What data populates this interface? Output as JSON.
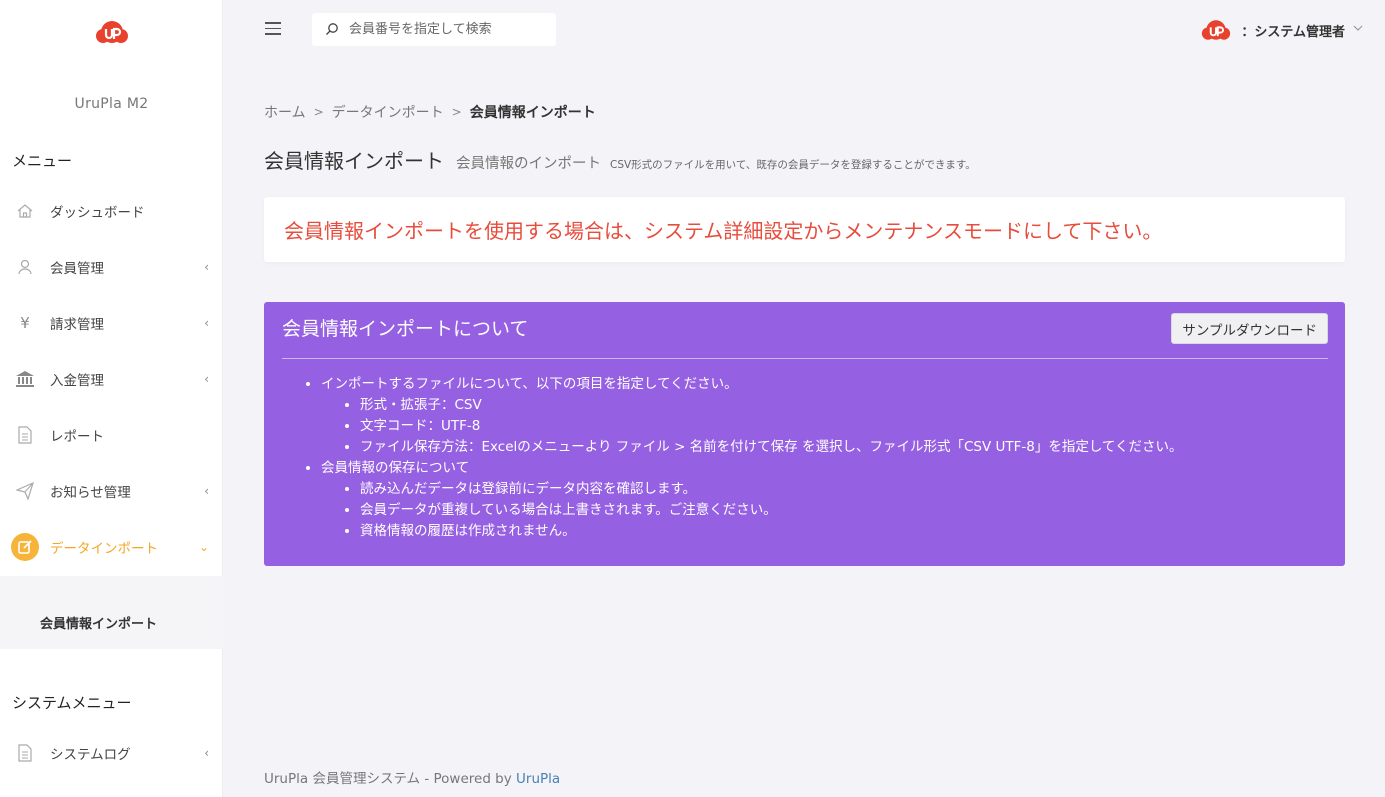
{
  "sidebar": {
    "app_name": "UruPla M2",
    "menu_title": "メニュー",
    "items": [
      {
        "label": "ダッシュボード",
        "icon": "home-icon"
      },
      {
        "label": "会員管理",
        "icon": "user-icon",
        "chevron": "‹"
      },
      {
        "label": "請求管理",
        "icon": "yen-icon",
        "chevron": "‹"
      },
      {
        "label": "入金管理",
        "icon": "bank-icon",
        "chevron": "‹"
      },
      {
        "label": "レポート",
        "icon": "document-icon"
      },
      {
        "label": "お知らせ管理",
        "icon": "send-icon",
        "chevron": "‹"
      },
      {
        "label": "データインポート",
        "icon": "edit-icon",
        "chevron": "⌄",
        "active": true
      }
    ],
    "submenu": {
      "label": "会員情報インポート"
    },
    "system_menu_title": "システムメニュー",
    "system_items": [
      {
        "label": "システムログ",
        "icon": "document-icon",
        "chevron": "‹"
      }
    ],
    "active_color": "#f6a623"
  },
  "header": {
    "search_placeholder": "会員番号を指定して検索",
    "user_label": "：システム管理者"
  },
  "breadcrumb": {
    "home": "ホーム",
    "parent": "データインポート",
    "current": "会員情報インポート",
    "sep1": ">",
    "sep2": ">"
  },
  "page": {
    "title": "会員情報インポート",
    "subtitle": "会員情報のインポート",
    "description": "CSV形式のファイルを用いて、既存の会員データを登録することができます。"
  },
  "alert": {
    "text": "会員情報インポートを使用する場合は、システム詳細設定からメンテナンスモードにして下さい。",
    "color": "#e74c3c"
  },
  "info_card": {
    "title": "会員情報インポートについて",
    "button_label": "サンプルダウンロード",
    "bg_color": "#9660e2",
    "sections": [
      {
        "heading": "インポートするファイルについて、以下の項目を指定してください。",
        "items": [
          "形式・拡張子：CSV",
          "文字コード：UTF-8",
          "ファイル保存方法：Excelのメニューより ファイル > 名前を付けて保存 を選択し、ファイル形式「CSV UTF-8」を指定してください。"
        ]
      },
      {
        "heading": "会員情報の保存について",
        "items": [
          "読み込んだデータは登録前にデータ内容を確認します。",
          "会員データが重複している場合は上書きされます。ご注意ください。",
          "資格情報の履歴は作成されません。"
        ]
      }
    ]
  },
  "footer": {
    "text": "UruPla 会員管理システム - Powered by ",
    "link": "UruPla"
  }
}
